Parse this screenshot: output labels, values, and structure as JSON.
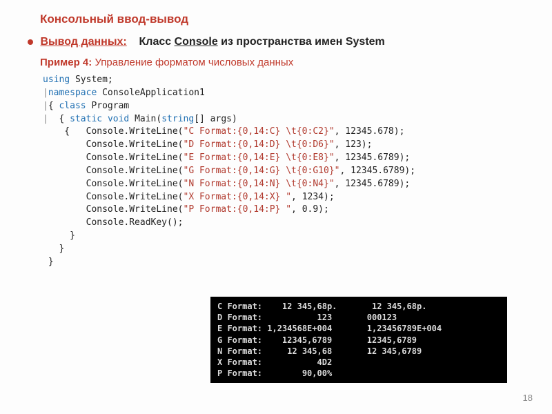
{
  "title": "Консольный ввод-вывод",
  "subtitle": {
    "output_label": "Вывод данных:",
    "class_prefix": "Класс",
    "class_name": "Console",
    "namespace_text": "из пространства имен System"
  },
  "example": {
    "label": "Пример 4:",
    "desc": "Управление форматом числовых данных"
  },
  "code": {
    "l1_kw": "using",
    "l1_rest": " System;",
    "l2_kw": "namespace",
    "l2_rest": " ConsoleApplication1",
    "l3": "{ ",
    "l3_kw": "class",
    "l3_rest": " Program",
    "l4a": "  { ",
    "l4_kw1": "static",
    "l4_kw2": "void",
    "l4_mid": " Main(",
    "l4_kw3": "string",
    "l4_end": "[] args)",
    "l5a": "    {   Console.WriteLine(",
    "l5s": "\"C Format:{0,14:C} \\t{0:C2}\"",
    "l5b": ", 12345.678);",
    "l6a": "        Console.WriteLine(",
    "l6s": "\"D Format:{0,14:D} \\t{0:D6}\"",
    "l6b": ", 123);",
    "l7a": "        Console.WriteLine(",
    "l7s": "\"E Format:{0,14:E} \\t{0:E8}\"",
    "l7b": ", 12345.6789);",
    "l8a": "        Console.WriteLine(",
    "l8s": "\"G Format:{0,14:G} \\t{0:G10}\"",
    "l8b": ", 12345.6789);",
    "l9a": "        Console.WriteLine(",
    "l9s": "\"N Format:{0,14:N} \\t{0:N4}\"",
    "l9b": ", 12345.6789);",
    "l10a": "        Console.WriteLine(",
    "l10s": "\"X Format:{0,14:X} \"",
    "l10b": ", 1234);",
    "l11a": "        Console.WriteLine(",
    "l11s": "\"P Format:{0,14:P} \"",
    "l11b": ", 0.9);",
    "l12": "        Console.ReadKey();",
    "l13": "     }",
    "l14": "   }",
    "l15": " }"
  },
  "output": "C Format:    12 345,68р.       12 345,68р.\nD Format:           123       000123\nE Format: 1,234568E+004       1,23456789E+004\nG Format:    12345,6789       12345,6789\nN Format:     12 345,68       12 345,6789\nX Format:           4D2\nP Format:        90,00%",
  "page_number": "18"
}
